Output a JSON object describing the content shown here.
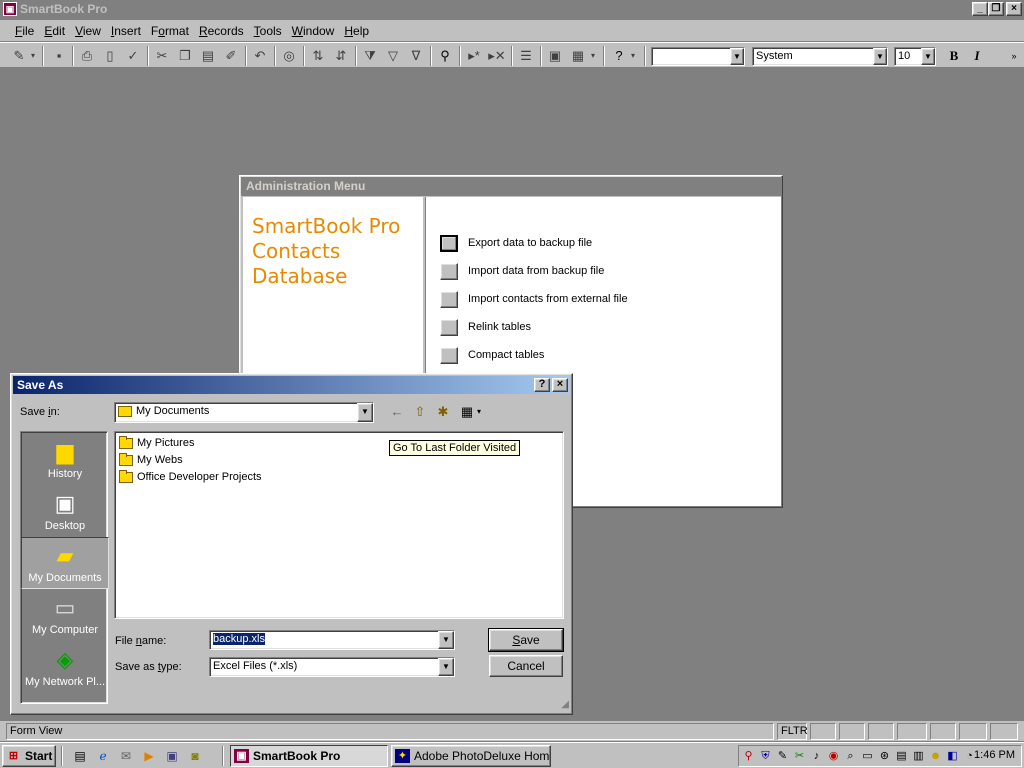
{
  "app": {
    "title": "SmartBook Pro",
    "controls": [
      "_",
      "❐",
      "×"
    ]
  },
  "menubar": {
    "items": [
      {
        "pre": "",
        "key": "F",
        "post": "ile"
      },
      {
        "pre": "",
        "key": "E",
        "post": "dit"
      },
      {
        "pre": "",
        "key": "V",
        "post": "iew"
      },
      {
        "pre": "",
        "key": "I",
        "post": "nsert"
      },
      {
        "pre": "F",
        "key": "o",
        "post": "rmat"
      },
      {
        "pre": "",
        "key": "R",
        "post": "ecords"
      },
      {
        "pre": "",
        "key": "T",
        "post": "ools"
      },
      {
        "pre": "",
        "key": "W",
        "post": "indow"
      },
      {
        "pre": "",
        "key": "H",
        "post": "elp"
      }
    ]
  },
  "toolbar": {
    "object_combo": "",
    "font_name": "System",
    "font_size": "10",
    "bold": "B",
    "italic": "I"
  },
  "admin": {
    "title": "Administration Menu",
    "brand_line1": "SmartBook Pro",
    "brand_line2": "Contacts",
    "brand_line3": "Database",
    "options": [
      "Export data to backup file",
      "Import data from backup file",
      "Import contacts from external file",
      "Relink tables",
      "Compact tables"
    ]
  },
  "saveas": {
    "title": "Save As",
    "help_btn": "?",
    "close_btn": "×",
    "save_in_pre": "Save ",
    "save_in_key": "i",
    "save_in_post": "n:",
    "save_in_value": "My Documents",
    "places": [
      "History",
      "Desktop",
      "My Documents",
      "My Computer",
      "My Network Pl..."
    ],
    "files": [
      "My Pictures",
      "My Webs",
      "Office Developer Projects"
    ],
    "tooltip": "Go To Last Folder Visited",
    "file_name_pre": "File ",
    "file_name_key": "n",
    "file_name_post": "ame:",
    "file_name_value": "backup.xls",
    "type_pre": "Save as ",
    "type_key": "t",
    "type_post": "ype:",
    "type_value": "Excel Files (*.xls)",
    "save_pre": "",
    "save_key": "S",
    "save_post": "ave",
    "cancel": "Cancel"
  },
  "statusbar": {
    "text": "Form View",
    "filter": "FLTR"
  },
  "taskbar": {
    "start": "Start",
    "tasks": [
      "SmartBook Pro",
      "Adobe PhotoDeluxe Home..."
    ],
    "clock": "1:46 PM"
  }
}
